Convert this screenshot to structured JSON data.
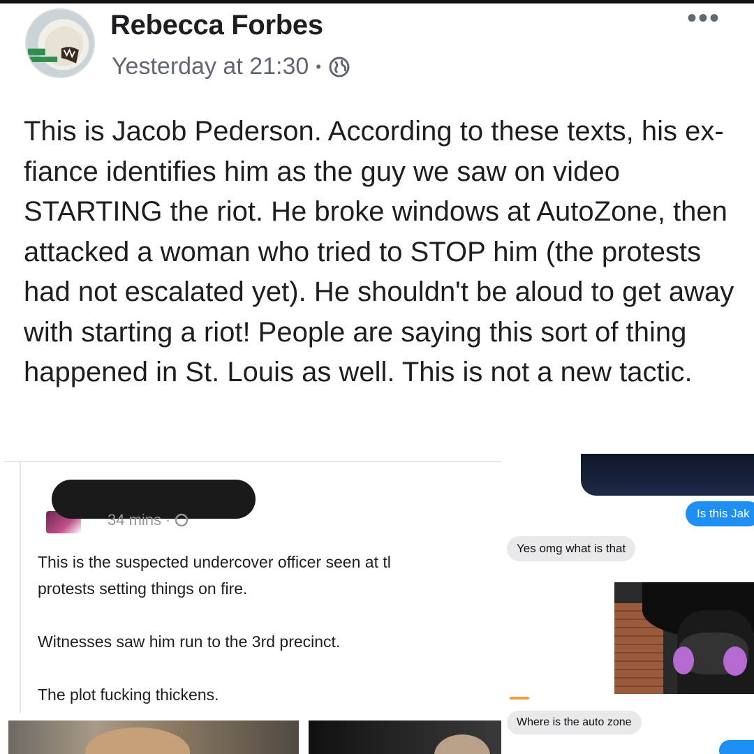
{
  "post": {
    "author": "Rebecca Forbes",
    "timestamp": "Yesterday at 21:30",
    "separator": "•",
    "more_label": "•••",
    "body": "This is Jacob Pederson. According to these texts, his ex-fiance identifies him as the guy we saw on video STARTING the riot. He broke windows at AutoZone, then attacked a woman who tried to STOP him (the protests had not escalated yet). He shouldn't be aloud to get away with starting a riot! People are saying this sort of thing happened in St. Louis as well. This is not a new tactic."
  },
  "embedded_post": {
    "time": "34 mins",
    "separator": "·",
    "line1": "This is the suspected undercover officer seen at tl",
    "line2": "protests setting things on fire.",
    "line3": "Witnesses saw him run to the 3rd precinct.",
    "line4": "The plot fucking thickens."
  },
  "conversation": {
    "msg_out_1": "Is this Jak",
    "msg_in_1": "Yes omg what is that",
    "msg_in_2": "Where is the auto zone"
  },
  "colors": {
    "accent_blue": "#1d8ef2",
    "bubble_gray": "#e9e9eb",
    "meta_gray": "#606770"
  }
}
